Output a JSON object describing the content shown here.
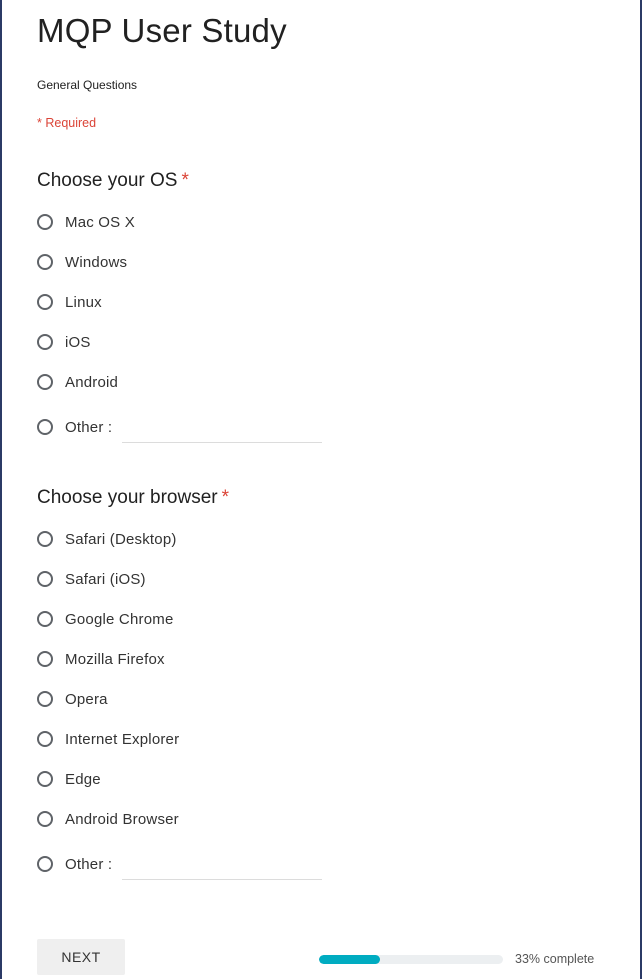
{
  "form": {
    "title": "MQP User Study",
    "description": "General Questions",
    "required_note": "* Required"
  },
  "questions": [
    {
      "title": "Choose your OS",
      "required_mark": "*",
      "options": [
        "Mac OS X",
        "Windows",
        "Linux",
        "iOS",
        "Android"
      ],
      "other_label": "Other :",
      "other_value": ""
    },
    {
      "title": "Choose your browser",
      "required_mark": "*",
      "options": [
        "Safari (Desktop)",
        "Safari (iOS)",
        "Google Chrome",
        "Mozilla Firefox",
        "Opera",
        "Internet Explorer",
        "Edge",
        "Android Browser"
      ],
      "other_label": "Other :",
      "other_value": ""
    }
  ],
  "footer": {
    "next_label": "NEXT",
    "progress_percent": 33,
    "progress_text": "33% complete"
  },
  "colors": {
    "required": "#db4437",
    "progress": "#00acc1",
    "frame": "#2b3a66"
  },
  "icons": {
    "radio": "radio-button-unchecked-icon"
  }
}
